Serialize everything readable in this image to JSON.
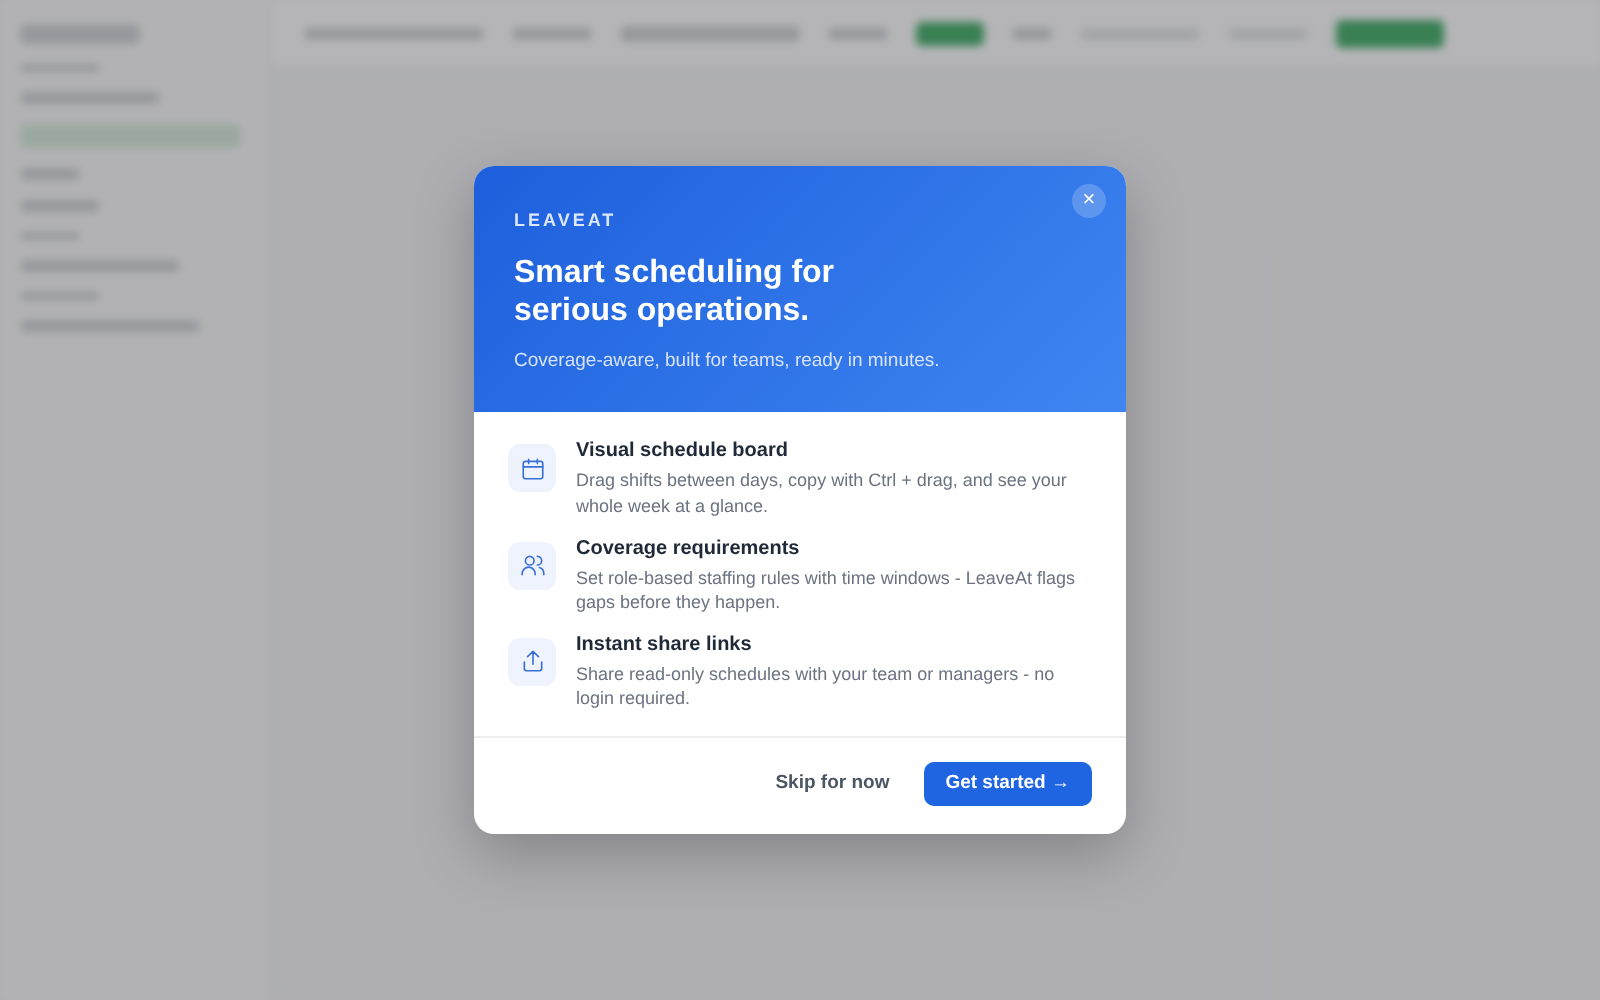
{
  "dialog": {
    "brand": "LEAVEAT",
    "title": "Smart scheduling for serious operations.",
    "subtitle": "Coverage-aware, built for teams, ready in minutes.",
    "close": "×",
    "features": [
      {
        "kind": "calendar",
        "title": "Visual schedule board",
        "text": "Drag shifts between days, copy with Ctrl + drag, and see your whole week at a glance."
      },
      {
        "kind": "people",
        "title": "Coverage requirements",
        "text": "Set role-based staffing rules with time windows - LeaveAt flags gaps before they happen."
      },
      {
        "kind": "share",
        "title": "Instant share links",
        "text": "Share read-only schedules with your team or managers - no login required."
      }
    ],
    "buttons": [
      {
        "kind": "secondary",
        "label": "Skip for now"
      },
      {
        "kind": "primary",
        "label": "Get started →"
      }
    ]
  }
}
